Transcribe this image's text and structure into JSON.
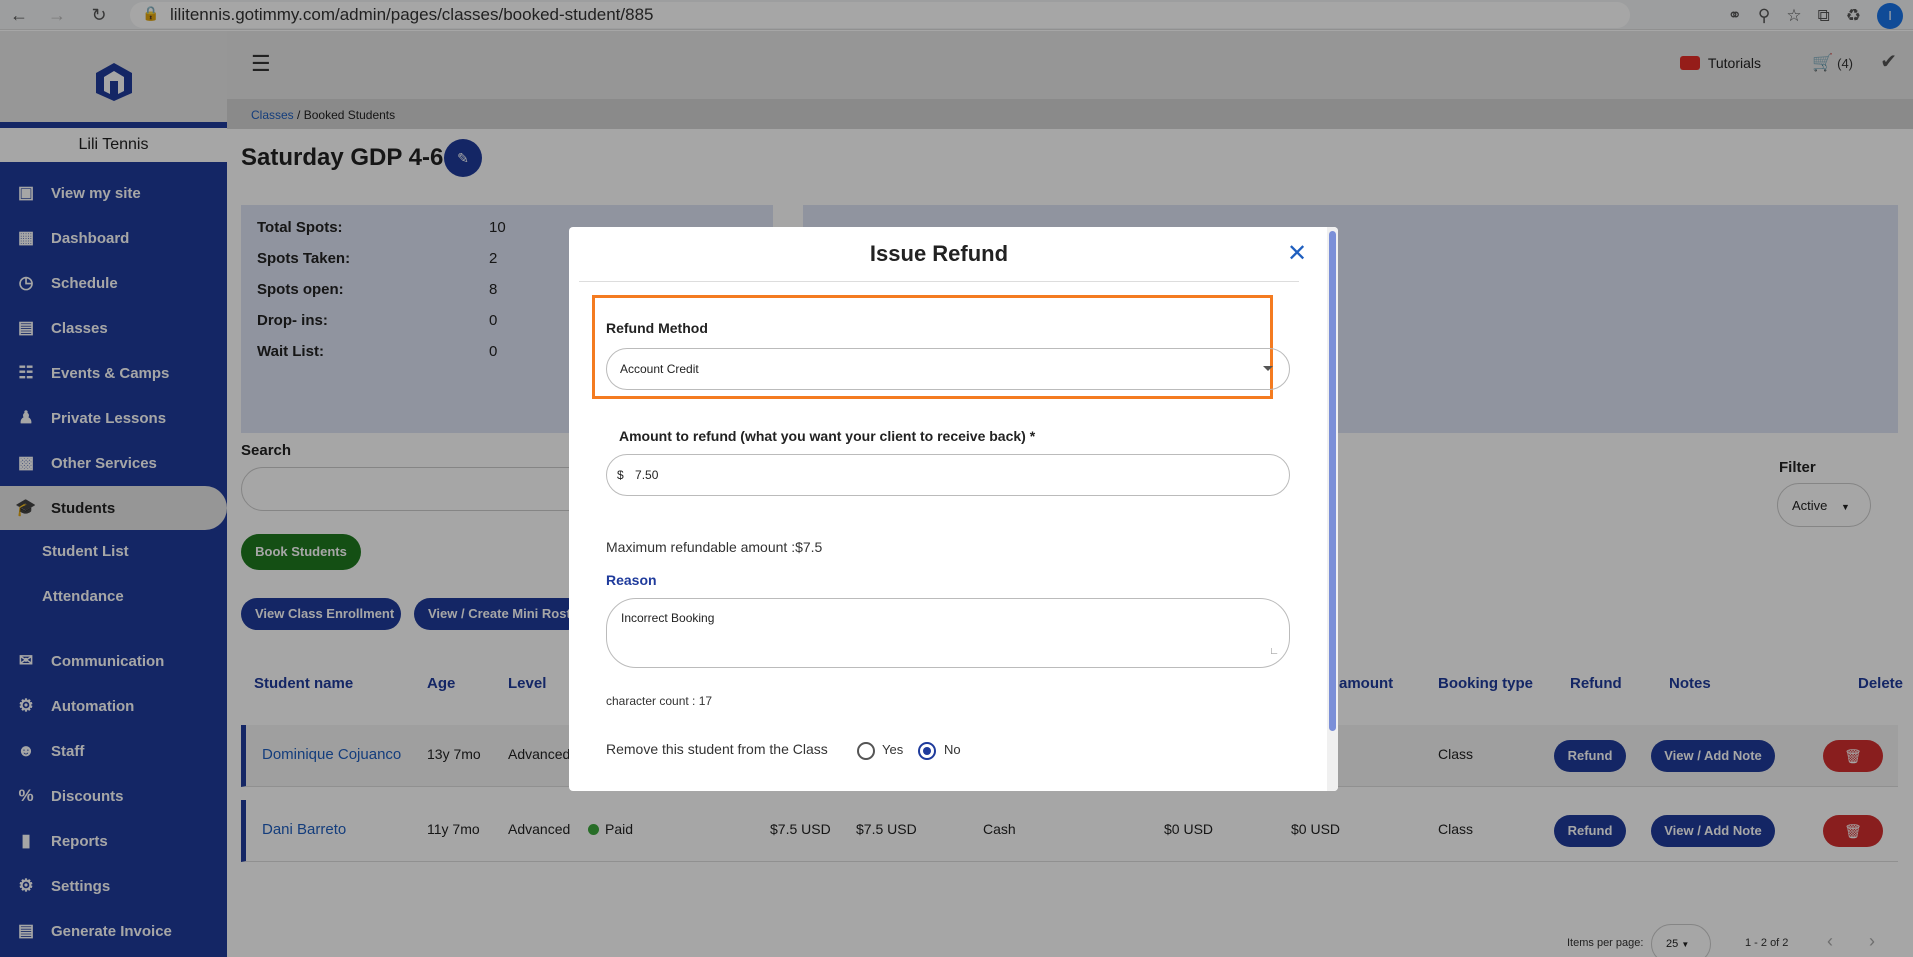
{
  "browser": {
    "url": "lilitennis.gotimmy.com/admin/pages/classes/booked-student/885",
    "profile_initial": "I"
  },
  "sidebar": {
    "org_name": "Lili Tennis",
    "items": [
      {
        "label": "View my site",
        "icon": "monitor-icon"
      },
      {
        "label": "Dashboard",
        "icon": "dashboard-icon"
      },
      {
        "label": "Schedule",
        "icon": "clock-icon"
      },
      {
        "label": "Classes",
        "icon": "book-icon"
      },
      {
        "label": "Events & Camps",
        "icon": "calendar-icon"
      },
      {
        "label": "Private Lessons",
        "icon": "person-icon"
      },
      {
        "label": "Other Services",
        "icon": "grid-icon"
      },
      {
        "label": "Students",
        "icon": "graduation-cap-icon"
      },
      {
        "label": "Communication",
        "icon": "chat-icon"
      },
      {
        "label": "Automation",
        "icon": "automation-icon"
      },
      {
        "label": "Staff",
        "icon": "people-icon"
      },
      {
        "label": "Discounts",
        "icon": "percent-icon"
      },
      {
        "label": "Reports",
        "icon": "reports-icon"
      },
      {
        "label": "Settings",
        "icon": "gear-icon"
      },
      {
        "label": "Generate Invoice",
        "icon": "invoice-icon"
      }
    ],
    "sub_items": [
      "Student List",
      "Attendance"
    ]
  },
  "topbar": {
    "tutorials": "Tutorials",
    "cart_count": "(4)"
  },
  "breadcrumb": {
    "link": "Classes",
    "separator": "/",
    "current": "Booked Students"
  },
  "page": {
    "title": "Saturday GDP 4-6"
  },
  "stats": [
    {
      "label": "Total Spots:",
      "value": "10"
    },
    {
      "label": "Spots Taken:",
      "value": "2"
    },
    {
      "label": "Spots open:",
      "value": "8"
    },
    {
      "label": "Drop- ins:",
      "value": "0"
    },
    {
      "label": "Wait List:",
      "value": "0"
    }
  ],
  "search": {
    "label": "Search"
  },
  "filter": {
    "label": "Filter",
    "value": "Active"
  },
  "buttons": {
    "book_students": "Book Students",
    "view_enrollment": "View Class Enrollment",
    "mini_roster": "View / Create Mini Roste"
  },
  "table": {
    "headers": [
      "Student name",
      "Age",
      "Level",
      "amount",
      "Booking type",
      "Refund",
      "Notes",
      "Delete"
    ],
    "refund_label": "Refund",
    "notes_label": "View / Add Note",
    "rows": [
      {
        "name": "Dominique Cojuanco",
        "age": "13y 7mo",
        "level": "Advanced",
        "booking_type": "Class"
      },
      {
        "name": "Dani Barreto",
        "age": "11y 7mo",
        "level": "Advanced",
        "status": "Paid",
        "price": "$7.5 USD",
        "paid": "$7.5 USD",
        "method": "Cash",
        "credit": "$0 USD",
        "refund_amount": "$0 USD",
        "booking_type": "Class"
      }
    ]
  },
  "pagination": {
    "items_label": "Items per page:",
    "per_page": "25",
    "range": "1 - 2 of 2"
  },
  "modal": {
    "title": "Issue Refund",
    "refund_method_label": "Refund Method",
    "refund_method_value": "Account Credit",
    "amount_label": "Amount to refund (what you want your client to receive back) *",
    "currency_prefix": "$",
    "amount_value": "7.50",
    "max_refundable": "Maximum refundable amount :$7.5",
    "reason_label": "Reason",
    "reason_value": "Incorrect Booking",
    "char_count": "character count : 17",
    "remove_label": "Remove this student from the Class",
    "yes_label": "Yes",
    "no_label": "No",
    "remove_selected": "No"
  }
}
